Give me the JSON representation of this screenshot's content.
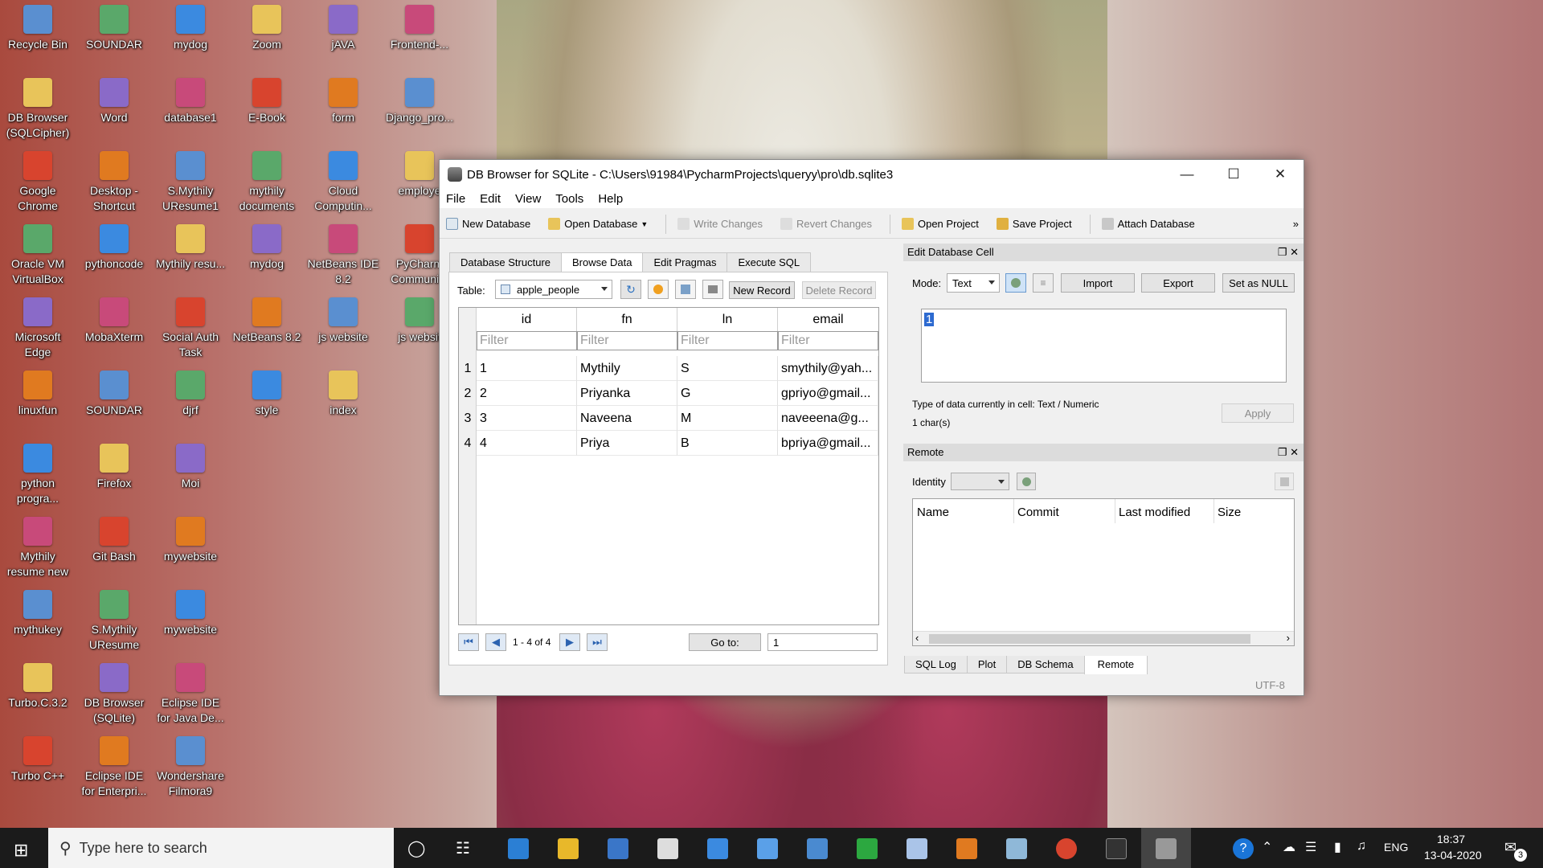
{
  "desktop": {
    "columns": [
      [
        "Recycle Bin",
        "DB Browser (SQLCipher)",
        "Google Chrome",
        "Oracle VM VirtualBox",
        "Microsoft Edge",
        "linuxfun",
        "python progra...",
        "Mythily resume new",
        "mythukey",
        "Turbo.C.3.2",
        "Turbo C++"
      ],
      [
        "SOUNDAR",
        "Word",
        "Desktop - Shortcut",
        "pythoncode",
        "MobaXterm",
        "SOUNDAR",
        "Firefox",
        "Git Bash",
        "S.Mythily UResume",
        "DB Browser (SQLite)",
        "Eclipse IDE for Enterpri..."
      ],
      [
        "mydog",
        "database1",
        "S.Mythily UResume1",
        "Mythily resu...",
        "Social Auth Task",
        "djrf",
        "Moi",
        "mywebsite",
        "mywebsite",
        "Eclipse IDE for Java De...",
        "Wondershare Filmora9"
      ],
      [
        "Zoom",
        "E-Book",
        "mythily documents",
        "mydog",
        "NetBeans 8.2",
        "style"
      ],
      [
        "jAVA",
        "form",
        "Cloud Computin...",
        "NetBeans IDE 8.2",
        "js website",
        "index"
      ],
      [
        "Frontend-...",
        "Django_pro...",
        "employe",
        "PyCharm Communi...",
        "js websit"
      ]
    ]
  },
  "window": {
    "title": "DB Browser for SQLite - C:\\Users\\91984\\PycharmProjects\\queryy\\pro\\db.sqlite3",
    "menu": [
      "File",
      "Edit",
      "View",
      "Tools",
      "Help"
    ],
    "toolbar": {
      "new_db": "New Database",
      "open_db": "Open Database",
      "write": "Write Changes",
      "revert": "Revert Changes",
      "open_proj": "Open Project",
      "save_proj": "Save Project",
      "attach": "Attach Database",
      "more": "»"
    },
    "tabs": [
      "Database Structure",
      "Browse Data",
      "Edit Pragmas",
      "Execute SQL"
    ],
    "browse": {
      "table_label": "Table:",
      "table_value": "apple_people",
      "new_record": "New Record",
      "delete_record": "Delete Record",
      "columns": [
        "id",
        "fn",
        "ln",
        "email"
      ],
      "filter_placeholder": "Filter",
      "rows": [
        {
          "n": "1",
          "id": "1",
          "fn": "Mythily",
          "ln": "S",
          "email": "smythily@yah..."
        },
        {
          "n": "2",
          "id": "2",
          "fn": "Priyanka",
          "ln": "G",
          "email": "gpriyo@gmail..."
        },
        {
          "n": "3",
          "id": "3",
          "fn": "Naveena",
          "ln": "M",
          "email": "naveeena@g..."
        },
        {
          "n": "4",
          "id": "4",
          "fn": "Priya",
          "ln": "B",
          "email": "bpriya@gmail..."
        }
      ],
      "pager": "1 - 4 of 4",
      "goto_label": "Go to:",
      "goto_value": "1"
    },
    "edit_cell": {
      "title": "Edit Database Cell",
      "mode_label": "Mode:",
      "mode_value": "Text",
      "import": "Import",
      "export": "Export",
      "set_null": "Set as NULL",
      "cell_value": "1",
      "type_info": "Type of data currently in cell: Text / Numeric",
      "chars": "1 char(s)",
      "apply": "Apply"
    },
    "remote": {
      "title": "Remote",
      "identity_label": "Identity",
      "columns": [
        "Name",
        "Commit",
        "Last modified",
        "Size"
      ]
    },
    "bottom_tabs": [
      "SQL Log",
      "Plot",
      "DB Schema",
      "Remote"
    ],
    "encoding": "UTF-8"
  },
  "taskbar": {
    "search_placeholder": "Type here to search",
    "lang": "ENG",
    "time": "18:37",
    "date": "13-04-2020",
    "notif_count": "3"
  }
}
